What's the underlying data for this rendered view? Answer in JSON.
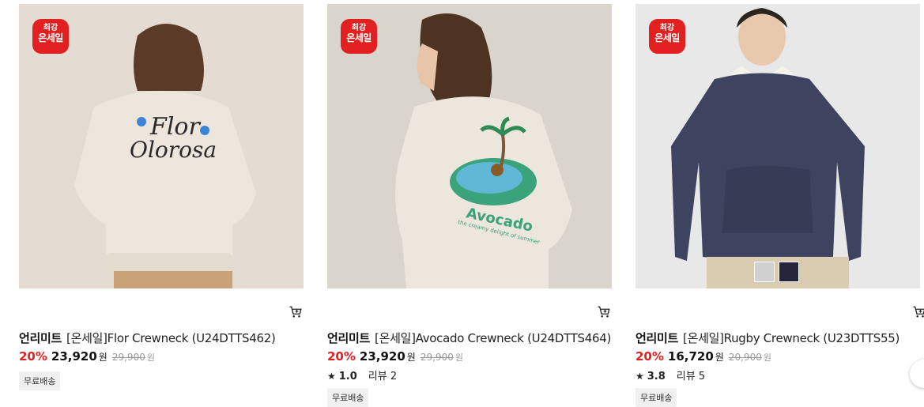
{
  "products": [
    {
      "badge_line1": "최강",
      "badge_line2": "온세일",
      "brand": "언리미트",
      "name": "[온세일]Flor Crewneck (U24DTTS462)",
      "discount": "20%",
      "sale_price": "23,920",
      "currency": "원",
      "original_price": "29,900",
      "original_currency": "원",
      "tag": "무료배송",
      "print_text_1": "Flor",
      "print_text_2": "Olorosa",
      "bg": "#e4dcd2"
    },
    {
      "badge_line1": "최강",
      "badge_line2": "온세일",
      "brand": "언리미트",
      "name": "[온세일]Avocado Crewneck (U24DTTS464)",
      "discount": "20%",
      "sale_price": "23,920",
      "currency": "원",
      "original_price": "29,900",
      "original_currency": "원",
      "rating": "1.0",
      "review_label": "리뷰 2",
      "tag": "무료배송",
      "print_text_1": "Avocado",
      "print_text_2": "the creamy delight of summer",
      "bg": "#d9d4cc"
    },
    {
      "badge_line1": "최강",
      "badge_line2": "온세일",
      "brand": "언리미트",
      "name": "[온세일]Rugby Crewneck (U23DTTS55)",
      "discount": "20%",
      "sale_price": "16,720",
      "currency": "원",
      "original_price": "20,900",
      "original_currency": "원",
      "rating": "3.8",
      "review_label": "리뷰 5",
      "tag": "무료배송",
      "bg": "#e8e8e8",
      "swatches": [
        "#d0d0d0",
        "#23263a"
      ]
    }
  ],
  "icons": {
    "cart": "cart-icon",
    "star": "star-icon"
  },
  "colors": {
    "accent": "#e1201f"
  }
}
